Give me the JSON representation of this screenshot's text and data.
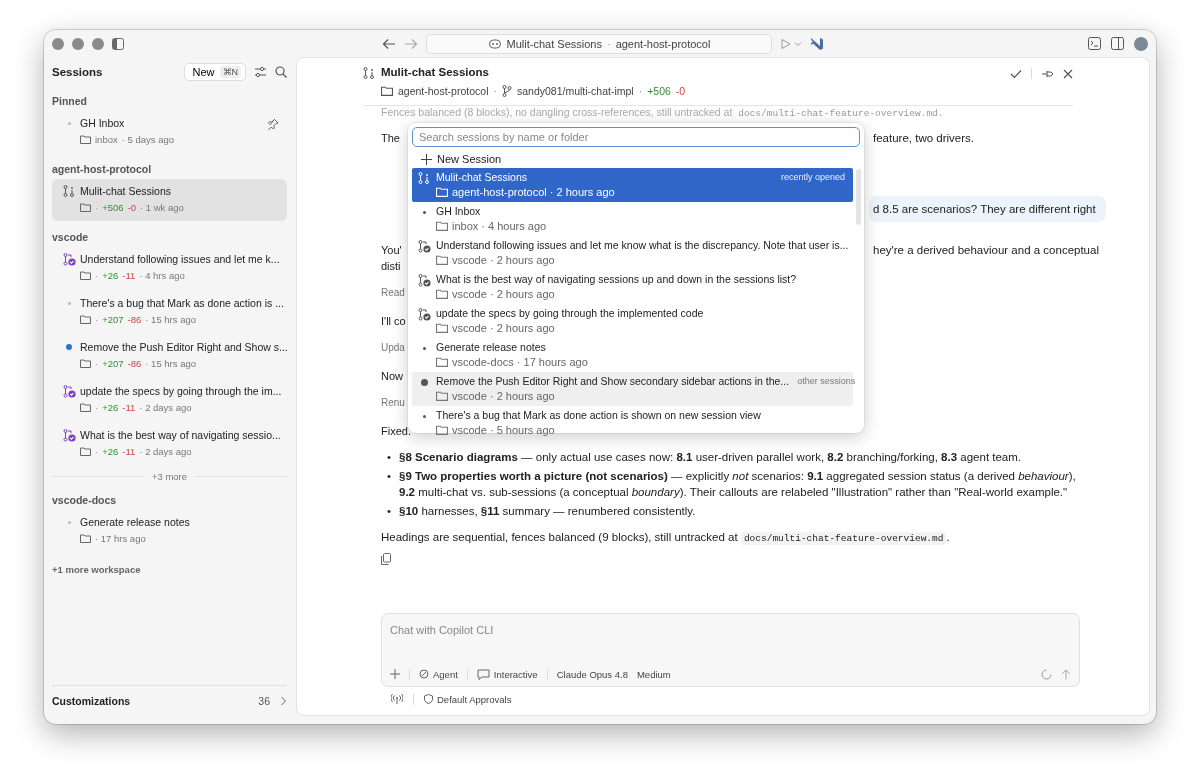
{
  "titlebar": {
    "title": "Mulit-chat Sessions",
    "separator": "·",
    "workspace": "agent-host-protocol"
  },
  "sidebar": {
    "title": "Sessions",
    "new_button": "New",
    "shortcut": "⌘N",
    "groups": [
      {
        "name": "Pinned",
        "sessions": [
          {
            "kind": "dot",
            "title": "GH Inbox",
            "folder": "inbox",
            "time": "· 5 days ago",
            "pinned": true,
            "selected": false
          }
        ]
      },
      {
        "name": "agent-host-protocol",
        "sessions": [
          {
            "kind": "multichat",
            "title": "Mulit-chat Sessions",
            "lead": "·",
            "added": "+506",
            "removed": "-0",
            "time": "· 1 wk ago",
            "pinned": false,
            "selected": true
          }
        ]
      },
      {
        "name": "vscode",
        "more": "+3 more",
        "sessions": [
          {
            "kind": "pr",
            "title": "Understand following issues and let me k...",
            "lead": "·",
            "added": "+26",
            "removed": "-11",
            "time": "· 4 hrs ago",
            "pinned": false,
            "selected": false
          },
          {
            "kind": "dot",
            "title": "There's a bug that Mark as done action is ...",
            "lead": "·",
            "added": "+207",
            "removed": "-86",
            "time": "· 15 hrs ago",
            "pinned": false,
            "selected": false
          },
          {
            "kind": "unread",
            "title": "Remove the Push Editor Right and Show s...",
            "lead": "·",
            "added": "+207",
            "removed": "-86",
            "time": "· 15 hrs ago",
            "pinned": false,
            "selected": false
          },
          {
            "kind": "pr",
            "title": "update the specs by going through the im...",
            "lead": "·",
            "added": "+26",
            "removed": "-11",
            "time": "· 2 days ago",
            "pinned": false,
            "selected": false
          },
          {
            "kind": "pr",
            "title": "What is the best way of navigating sessio...",
            "lead": "·",
            "added": "+26",
            "removed": "-11",
            "time": "· 2 days ago",
            "pinned": false,
            "selected": false
          }
        ]
      },
      {
        "name": "vscode-docs",
        "sessions": [
          {
            "kind": "dot",
            "title": "Generate release notes",
            "time": "· 17 hrs ago",
            "pinned": false,
            "selected": false
          }
        ]
      }
    ],
    "more_workspaces": "+1 more workspace",
    "customizations": {
      "label": "Customizations",
      "count": "36"
    }
  },
  "header": {
    "title": "Mulit-chat Sessions",
    "folder": "agent-host-protocol",
    "separators": [
      "·",
      "·"
    ],
    "branch": "sandy081/multi-chat-impl",
    "added": "+506",
    "removed": "-0"
  },
  "chat": {
    "faded_line": {
      "text": "Fences balanced (8 blocks), no dangling cross-references, still untracked at",
      "code": "docs/multi-chat-feature-overview.md."
    },
    "messages": [
      {
        "kind": "split",
        "left": "The",
        "right": "feature, two drivers."
      },
      {
        "kind": "user",
        "right": "d 8.5 are scenarios? They are different right"
      },
      {
        "kind": "split",
        "left": "You'\ndisti",
        "right": "hey're a derived behaviour and a conceptual"
      },
      {
        "kind": "note",
        "left": "Read"
      },
      {
        "kind": "split",
        "left": "I'll co"
      },
      {
        "kind": "note",
        "left": "Upda"
      },
      {
        "kind": "split",
        "left": "Now"
      },
      {
        "kind": "note",
        "left": "Renu"
      },
      {
        "kind": "split",
        "left": "Fixed."
      }
    ],
    "bullets": [
      {
        "marker": "•",
        "text": "**§8 Scenario diagrams** — only actual use cases now: **8.1** user-driven parallel work, **8.2** branching/forking, **8.3** agent team."
      },
      {
        "marker": "•",
        "text": "**§9 Two properties worth a picture (not scenarios)** — explicitly *not* scenarios: **9.1** aggregated session status (a derived *behaviour*), **9.2** multi-chat vs. sub-sessions (a conceptual *boundary*). Their callouts are relabeled \"Illustration\" rather than \"Real-world example.\""
      },
      {
        "marker": "•",
        "text": "**§10** harnesses, **§11** summary — renumbered consistently."
      }
    ],
    "closing": {
      "text": "Headings are sequential, fences balanced (9 blocks), still untracked at",
      "code": "docs/multi-chat-feature-overview.md",
      "end": "."
    }
  },
  "picker": {
    "placeholder": "Search sessions by name or folder",
    "new_session": "New Session",
    "items": [
      {
        "kind": "multichat",
        "title": "Mulit-chat Sessions",
        "meta": "agent-host-protocol · 2 hours ago",
        "tag": "recently opened",
        "selected": true,
        "hovered": false
      },
      {
        "kind": "dot",
        "title": "GH Inbox",
        "meta": "inbox · 4 hours ago",
        "selected": false,
        "hovered": false
      },
      {
        "kind": "pr",
        "title": "Understand following issues and let me know what is the discrepancy. Note that user is...",
        "meta": "vscode · 2 hours ago",
        "selected": false,
        "hovered": false
      },
      {
        "kind": "pr",
        "title": "What is the best way of navigating sessions up and down in the sessions list?",
        "meta": "vscode · 2 hours ago",
        "selected": false,
        "hovered": false
      },
      {
        "kind": "pr",
        "title": "update the specs by going through the implemented code",
        "meta": "vscode · 2 hours ago",
        "selected": false,
        "hovered": false
      },
      {
        "kind": "dot",
        "title": "Generate release notes",
        "meta": "vscode-docs · 17 hours ago",
        "selected": false,
        "hovered": false
      },
      {
        "kind": "unread",
        "title": "Remove the Push Editor Right and Show secondary sidebar actions in the...",
        "meta": "vscode · 2 hours ago",
        "tag": "other sessions",
        "selected": false,
        "hovered": true
      },
      {
        "kind": "dot",
        "title": "There's a bug that Mark as done action is shown on new session view",
        "meta": "vscode · 5 hours ago",
        "selected": false,
        "hovered": false
      }
    ]
  },
  "composer": {
    "placeholder": "Chat with Copilot CLI",
    "mode": "Agent",
    "interaction": "Interactive",
    "model": "Claude Opus 4.8",
    "effort": "Medium",
    "approvals": "Default Approvals"
  }
}
